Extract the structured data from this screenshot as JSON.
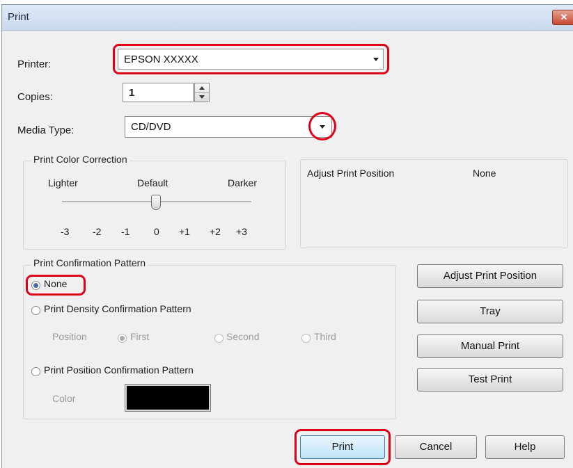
{
  "window": {
    "title": "Print",
    "close_glyph": "✕"
  },
  "printer": {
    "label": "Printer:",
    "value": "EPSON XXXXX"
  },
  "copies": {
    "label": "Copies:",
    "value": "1"
  },
  "media_type": {
    "label": "Media Type:",
    "value": "CD/DVD"
  },
  "color_correction": {
    "title": "Print Color Correction",
    "lighter": "Lighter",
    "default": "Default",
    "darker": "Darker",
    "ticks": [
      "-3",
      "-2",
      "-1",
      "0",
      "+1",
      "+2",
      "+3"
    ],
    "selected_value": "0"
  },
  "adjust_position_panel": {
    "label": "Adjust Print Position",
    "value": "None"
  },
  "confirmation": {
    "title": "Print Confirmation Pattern",
    "none": "None",
    "density": "Print Density Confirmation Pattern",
    "position_label": "Position",
    "first": "First",
    "second": "Second",
    "third": "Third",
    "position_pattern": "Print Position Confirmation Pattern",
    "color_label": "Color",
    "selected": "None",
    "color_value": "#000000"
  },
  "side_buttons": {
    "adjust": "Adjust Print Position",
    "tray": "Tray",
    "manual": "Manual Print",
    "test": "Test Print"
  },
  "footer": {
    "print": "Print",
    "cancel": "Cancel",
    "help": "Help"
  },
  "colors": {
    "highlight_ring": "#e0001a",
    "titlebar": "#c9d9ee"
  }
}
